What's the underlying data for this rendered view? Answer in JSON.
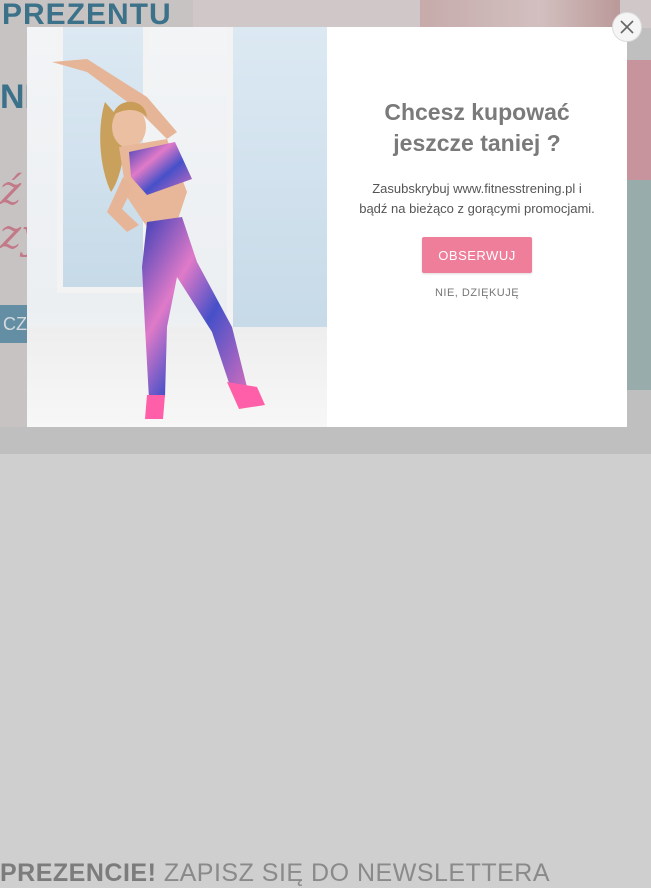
{
  "background_page": {
    "headline_fragment": "PREZENTU",
    "letter_fragment": "NE",
    "script_fragment_1": "ź",
    "script_fragment_2": "zy",
    "button_fragment": "CZ",
    "footer_bold": "PREZENCIE!",
    "footer_text": " ZAPISZ SIĘ DO NEWSLETTERA"
  },
  "popup": {
    "title": "Chcesz kupować jeszcze taniej ?",
    "description": "Zasubskrybuj www.fitnesstrening.pl i bądź na bieżąco z gorącymi promocjami.",
    "subscribe_label": "OBSERWUJ",
    "decline_label": "NIE, DZIĘKUJĘ",
    "close_icon": "close-icon"
  },
  "colors": {
    "accent": "#ee7e9a",
    "title": "#7a7a7a",
    "bg_blue": "#2f6f8e"
  }
}
